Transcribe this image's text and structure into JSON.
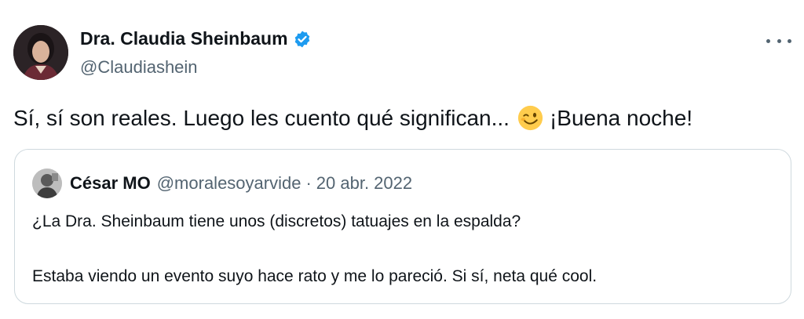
{
  "author": {
    "display_name": "Dra. Claudia Sheinbaum",
    "handle": "@Claudiashein",
    "verified": true,
    "avatar_icon": "profile-photo"
  },
  "menu": {
    "icon": "more-options-icon"
  },
  "tweet": {
    "text_before_emoji": "Sí, sí son reales. Luego les cuento qué significan...",
    "emoji": "winking-face-emoji",
    "text_after_emoji": "¡Buena noche!"
  },
  "quoted_tweet": {
    "display_name": "César MO",
    "handle": "@moralesoyarvide",
    "separator": "·",
    "date": "20 abr. 2022",
    "line1": "¿La Dra. Sheinbaum tiene unos (discretos) tatuajes en la espalda?",
    "line2": "Estaba viendo un evento suyo hace rato y me lo pareció. Si sí, neta qué cool."
  },
  "colors": {
    "verified_blue": "#1d9bf0",
    "secondary_text": "#536471",
    "border": "#cfd9de"
  }
}
